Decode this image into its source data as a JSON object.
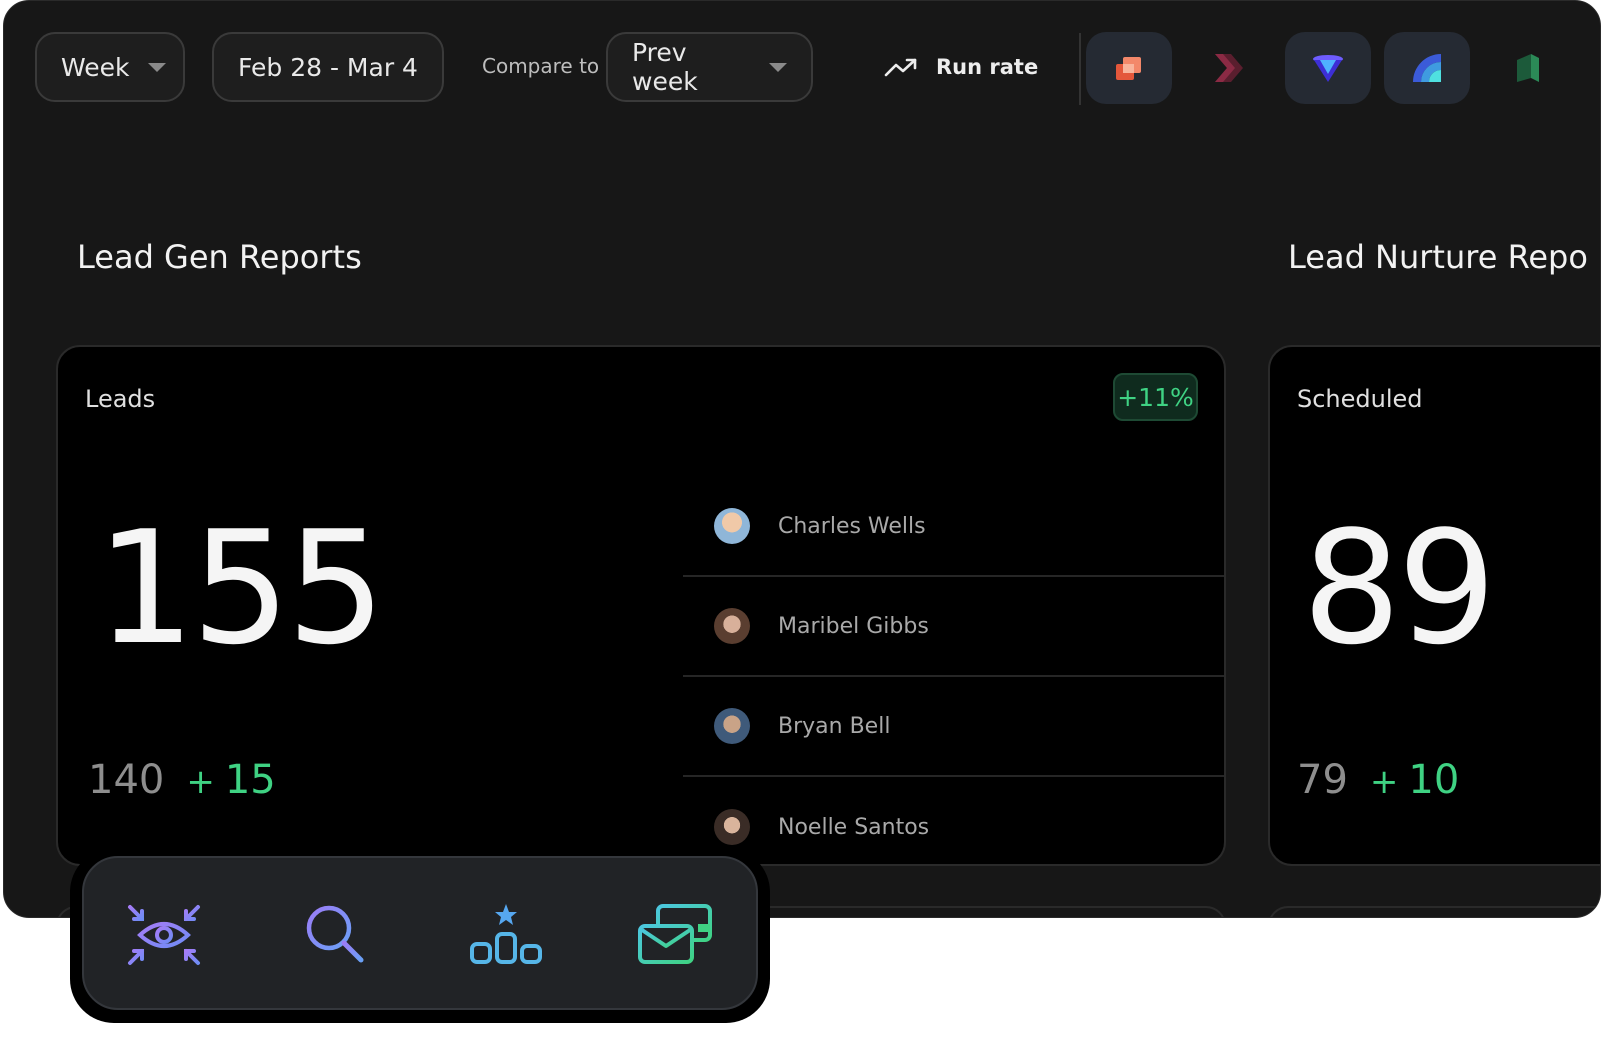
{
  "toolbar": {
    "period": "Week",
    "date_range": "Feb 28 - Mar 4",
    "compare_label": "Compare to",
    "compare_value": "Prev week",
    "run_rate": "Run rate",
    "app_icons": [
      "stack-app-icon",
      "chevron-app-icon",
      "funnel-app-icon",
      "rainbow-app-icon",
      "book-app-icon"
    ]
  },
  "sections": {
    "lead_gen_title": "Lead Gen Reports",
    "lead_nurture_title": "Lead Nurture Repo"
  },
  "leads_card": {
    "label": "Leads",
    "badge": "+11%",
    "value": "155",
    "previous": "140",
    "plus": "+",
    "delta": "15",
    "people": [
      "Charles Wells",
      "Maribel Gibbs",
      "Bryan Bell",
      "Noelle Santos"
    ]
  },
  "scheduled_card": {
    "label": "Scheduled",
    "value": "89",
    "previous": "79",
    "plus": "+",
    "delta": "10"
  },
  "dock": {
    "icons": [
      "focus-eye-icon",
      "analytics-search-icon",
      "leaderboard-icon",
      "email-cards-icon"
    ]
  },
  "colors": {
    "accent_green": "#3fd283",
    "background": "#171717",
    "card": "#000000"
  }
}
